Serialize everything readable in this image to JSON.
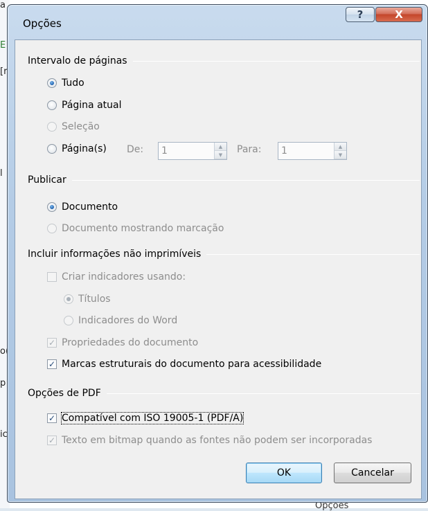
{
  "background": {
    "fragments": [
      "a",
      "E",
      "[r",
      "l",
      "o(",
      "p",
      "ic"
    ],
    "bottom_text": "Opções"
  },
  "window": {
    "title": "Opções",
    "help_label": "?",
    "close_label": "X"
  },
  "groups": {
    "page_range": {
      "heading": "Intervalo de páginas",
      "all": "Tudo",
      "current_page": "Página atual",
      "selection": "Seleção",
      "pages": "Página(s)",
      "from_label": "De:",
      "from_value": "1",
      "to_label": "Para:",
      "to_value": "1"
    },
    "publish": {
      "heading": "Publicar",
      "document": "Documento",
      "document_markup": "Documento mostrando marcação"
    },
    "nonprint": {
      "heading": "Incluir informações não imprimíveis",
      "create_bookmarks": "Criar indicadores usando:",
      "headings": "Títulos",
      "word_bookmarks": "Indicadores do Word",
      "doc_properties": "Propriedades do documento",
      "struct_tags": "Marcas estruturais do documento para acessibilidade"
    },
    "pdf": {
      "heading": "Opções de PDF",
      "iso": "Compatível com ISO 19005-1 (PDF/A)",
      "bitmap": "Texto em bitmap quando as fontes não podem ser incorporadas"
    }
  },
  "buttons": {
    "ok": "OK",
    "cancel": "Cancelar"
  },
  "state": {
    "page_range_selected": "Tudo",
    "publish_selected": "Documento",
    "create_bookmarks_checked": false,
    "doc_properties_checked": true,
    "struct_tags_checked": true,
    "iso_checked": true,
    "bitmap_checked": true
  }
}
